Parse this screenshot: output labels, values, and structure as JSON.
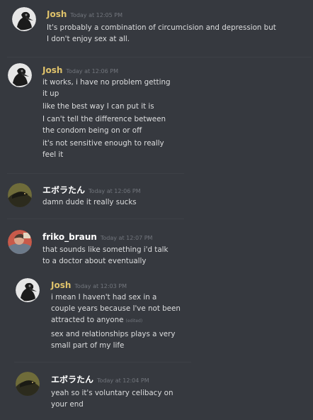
{
  "colors": {
    "background": "#36393f",
    "josh": "#e0c36b",
    "ebora": "#ffffff",
    "friko": "#ffffff",
    "text": "#dcddde",
    "timestamp": "#72767d"
  },
  "messages": [
    {
      "author": "Josh",
      "timestamp": "Today at 12:05 PM",
      "lines": [
        "It's probably a combination of circumcision and depression but",
        "I don't enjoy sex at all."
      ]
    },
    {
      "author": "Josh",
      "timestamp": "Today at 12:06 PM",
      "lines": [
        "it works, i have no problem getting",
        "it up",
        "like the best way I can put it is",
        "I can't tell the difference between",
        "the condom being on or off",
        "it's not sensitive enough to really",
        "feel it"
      ]
    },
    {
      "author": "エボラたん",
      "timestamp": "Today at 12:06 PM",
      "lines": [
        "damn dude it really sucks"
      ]
    },
    {
      "author": "friko_braun",
      "timestamp": "Today at 12:07 PM",
      "lines": [
        "that sounds like something i'd talk",
        "to a doctor about eventually"
      ]
    },
    {
      "author": "Josh",
      "timestamp": "Today at 12:03 PM",
      "lines": [
        "i mean I haven't had sex in a",
        "couple years because I've not been",
        "attracted to anyone",
        "sex and relationships plays a very",
        "small part of my life"
      ],
      "edited_label": "(edited)"
    },
    {
      "author": "エボラたん",
      "timestamp": "Today at 12:04 PM",
      "lines": [
        "yeah so it's voluntary celibacy on",
        "your end"
      ]
    }
  ]
}
